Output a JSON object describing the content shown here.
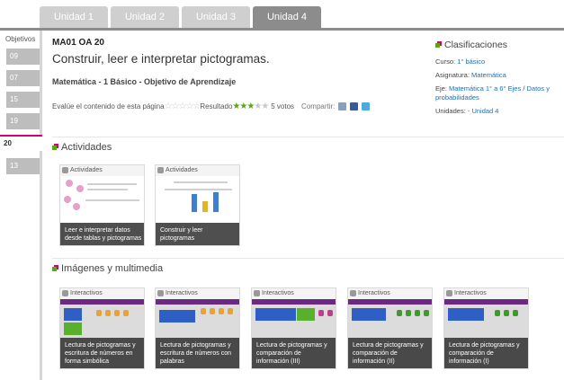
{
  "tabs": [
    {
      "label": "Unidad 1",
      "active": false
    },
    {
      "label": "Unidad 2",
      "active": false
    },
    {
      "label": "Unidad 3",
      "active": false
    },
    {
      "label": "Unidad 4",
      "active": true
    }
  ],
  "objectives": {
    "title": "Objetivos",
    "items": [
      "09",
      "07",
      "15",
      "19",
      "20",
      "13"
    ],
    "active": "20"
  },
  "header": {
    "code": "MA01 OA 20",
    "title": "Construir, leer e interpretar pictogramas.",
    "subject": "Matemática - 1 Básico - Objetivo de Aprendizaje"
  },
  "rating": {
    "prompt": "Evalúe el contenido de esta página",
    "result_label": "Resultado",
    "votes": "5 votos",
    "share_label": "Compartir:"
  },
  "classifications": {
    "title": "Clasificaciones",
    "curso_label": "Curso:",
    "curso_value": "1° básico",
    "asignatura_label": "Asignatura:",
    "asignatura_value": "Matemática",
    "eje_label": "Eje:",
    "eje_value1": "Matemática 1° a 6° Ejes",
    "eje_sep": "/",
    "eje_value2": "Datos y probabilidades",
    "unidades_label": "Unidades:",
    "unidades_value": "- Unidad 4"
  },
  "actividades": {
    "title": "Actividades",
    "cards": [
      {
        "tag": "Actividades",
        "caption": "Leer e interpretar datos desde tablas y pictogramas"
      },
      {
        "tag": "Actividades",
        "caption": "Construir y leer pictogramas"
      }
    ]
  },
  "multimedia": {
    "title": "Imágenes y multimedia",
    "cards": [
      {
        "tag": "Interactivos",
        "caption": "Lectura de pictogramas y escritura de números en forma simbólica"
      },
      {
        "tag": "Interactivos",
        "caption": "Lectura de pictogramas y escritura de números con palabras"
      },
      {
        "tag": "Interactivos",
        "caption": "Lectura de pictogramas y comparación de información (III)"
      },
      {
        "tag": "Interactivos",
        "caption": "Lectura de pictogramas y comparación de información (II)"
      },
      {
        "tag": "Interactivos",
        "caption": "Lectura de pictogramas y comparación de información (I)"
      }
    ]
  },
  "colors": {
    "accent_pink": "#d6006f",
    "accent_green": "#5aa61b",
    "link_blue": "#1f6fb2",
    "tab_active": "#8c8c8c",
    "tab_inactive": "#cfcfcf"
  }
}
